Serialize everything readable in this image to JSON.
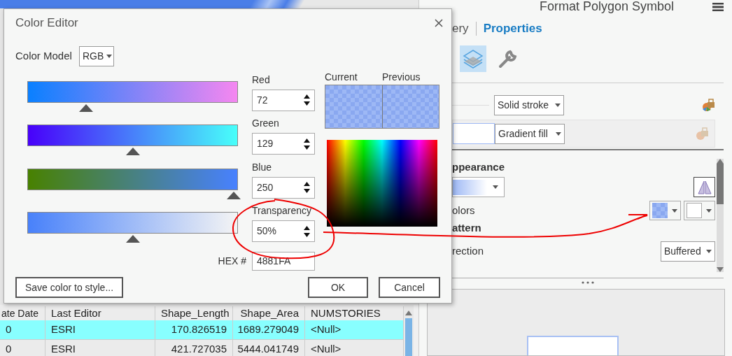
{
  "background_table": {
    "columns": [
      "ate Date",
      "Last Editor",
      "Shape_Length",
      "Shape_Area",
      "NUMSTORIES"
    ],
    "rows": [
      {
        "selected": true,
        "cells": [
          "0",
          "ESRI",
          "170.826519",
          "1689.279049",
          "<Null>"
        ]
      },
      {
        "selected": false,
        "cells": [
          "0",
          "ESRI",
          "421.727035",
          "5444.041749",
          "<Null>"
        ]
      }
    ]
  },
  "symbol_pane": {
    "title": "Format Polygon Symbol",
    "tabs": [
      {
        "label": "ery",
        "selected": false
      },
      {
        "label": "Properties",
        "selected": true
      }
    ],
    "tool_icons": [
      {
        "kind": "layers",
        "selected": true
      },
      {
        "kind": "wrench",
        "selected": false
      }
    ],
    "stroke_dropdown": "Solid stroke",
    "fill_dropdown": "Gradient fill",
    "section_title": "ppearance",
    "colors_label": "olors",
    "pattern_title": "attern",
    "direction_label": "rection",
    "direction_value": "Buffered"
  },
  "dialog": {
    "title": "Color Editor",
    "color_model_label": "Color Model",
    "color_model": "RGB",
    "channels": [
      {
        "kind": "red",
        "label": "Red",
        "value": "72",
        "level": 0.28
      },
      {
        "kind": "green",
        "label": "Green",
        "value": "129",
        "level": 0.5
      },
      {
        "kind": "blue",
        "label": "Blue",
        "value": "250",
        "level": 0.98
      },
      {
        "kind": "transparency",
        "label": "Transparency",
        "value": "50%",
        "level": 0.5
      }
    ],
    "current_label": "Current",
    "previous_label": "Previous",
    "hex_label": "HEX #",
    "hex": "4881FA",
    "buttons": [
      "Save color to style...",
      "OK",
      "Cancel"
    ]
  }
}
